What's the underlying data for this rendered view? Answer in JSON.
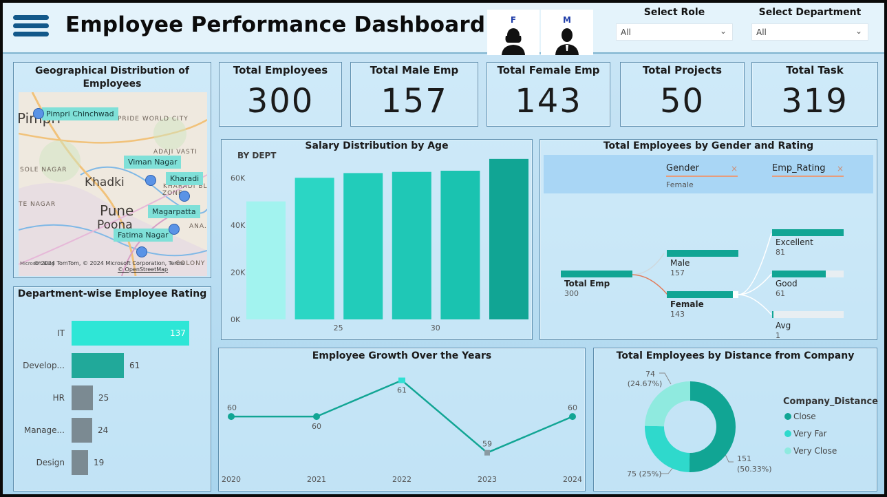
{
  "header": {
    "title": "Employee Performance Dashboard",
    "gender_buttons": [
      {
        "label": "F"
      },
      {
        "label": "M"
      }
    ],
    "slicers": [
      {
        "title": "Select Role",
        "value": "All"
      },
      {
        "title": "Select Department",
        "value": "All"
      }
    ]
  },
  "kpis": [
    {
      "title": "Total Employees",
      "value": "300"
    },
    {
      "title": "Total Male Emp",
      "value": "157"
    },
    {
      "title": "Total Female Emp",
      "value": "143"
    },
    {
      "title": "Total Projects",
      "value": "50"
    },
    {
      "title": "Total Task",
      "value": "319"
    }
  ],
  "map": {
    "title": "Geographical Distribution of Employees",
    "locations": [
      "Pimpri Chinchwad",
      "Viman Nagar",
      "Kharadi",
      "Magarpatta",
      "Fatima Nagar"
    ],
    "places": {
      "pimpri": "Pimpri",
      "khadki": "Khadki",
      "pune": "Pune",
      "poona": "Poona",
      "pride": "PRIDE WORLD CITY",
      "adaji": "ADAJI VASTI",
      "sole": "SOLE NAGAR",
      "te_nagar": "TE NAGAR",
      "kharadi_block": "KHARADI BLOCK",
      "zone": "ZONE",
      "ana": "ANA.",
      "colony": "COLONY"
    },
    "credit": "© 2024 TomTom, © 2024 Microsoft Corporation, Terms",
    "credit2": "© OpenStreetMap",
    "ms_logo": "Microsoft Bing"
  },
  "dept_rating": {
    "title": "Department-wise Employee Rating",
    "rows": [
      {
        "label": "IT",
        "value": 137
      },
      {
        "label": "Develop...",
        "value": 61
      },
      {
        "label": "HR",
        "value": 25
      },
      {
        "label": "Manage...",
        "value": 24
      },
      {
        "label": "Design",
        "value": 19
      }
    ],
    "colors": [
      "#2ee6d6",
      "#21a99a",
      "#7b8a92",
      "#7b8a92",
      "#7b8a92"
    ]
  },
  "salary_chart": {
    "title": "Salary Distribution by Age",
    "subtitle": "BY DEPT"
  },
  "decomp": {
    "title": "Total Employees by Gender and Rating",
    "filters": [
      {
        "head": "Gender",
        "value": "Female"
      },
      {
        "head": "Emp_Rating",
        "value": ""
      }
    ],
    "root": {
      "label": "Total Emp",
      "value": "300"
    },
    "level1": [
      {
        "label": "Male",
        "value": "157"
      },
      {
        "label": "Female",
        "value": "143"
      }
    ],
    "level2": [
      {
        "label": "Excellent",
        "value": "81"
      },
      {
        "label": "Good",
        "value": "61"
      },
      {
        "label": "Avg",
        "value": "1"
      }
    ]
  },
  "growth_chart": {
    "title": "Employee Growth Over the Years"
  },
  "distance_chart": {
    "title": "Total Employees by Distance from Company",
    "legend_title": "Company_Distance",
    "labels": {
      "close": "151",
      "close_pct": "(50.33%)",
      "very_far": "75 (25%)",
      "very_close": "74",
      "very_close_pct": "(24.67%)"
    }
  },
  "chart_data": [
    {
      "type": "bar",
      "title": "Salary Distribution by Age",
      "categories": [
        "",
        "25",
        "",
        "30",
        "",
        ""
      ],
      "values": [
        50000,
        60000,
        62000,
        62500,
        63000,
        68000
      ],
      "ylim": [
        0,
        70000
      ],
      "yticks": [
        "0K",
        "20K",
        "40K",
        "60K"
      ],
      "colors": [
        "#a2f3ef",
        "#2bd6c4",
        "#22ccba",
        "#1fc8b6",
        "#1ac3b0",
        "#11a594"
      ]
    },
    {
      "type": "line",
      "title": "Employee Growth Over the Years",
      "x": [
        "2020",
        "2021",
        "2022",
        "2023",
        "2024"
      ],
      "values": [
        60,
        60,
        61,
        59,
        60
      ],
      "ylim": [
        58.5,
        61.2
      ]
    },
    {
      "type": "pie",
      "title": "Total Employees by Distance from Company",
      "series": [
        {
          "name": "Close",
          "value": 151,
          "color": "#11a594"
        },
        {
          "name": "Very Far",
          "value": 75,
          "color": "#2fd9cc"
        },
        {
          "name": "Very Close",
          "value": 74,
          "color": "#8feadf"
        }
      ]
    }
  ]
}
